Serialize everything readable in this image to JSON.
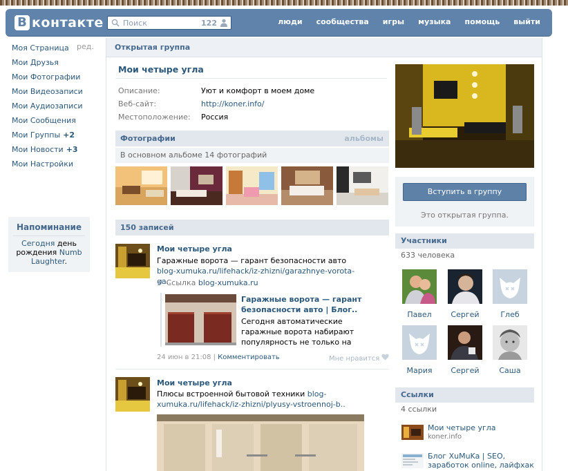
{
  "header": {
    "logo_letter": "В",
    "logo_text": "контакте",
    "search_placeholder": "Поиск",
    "search_count": "122",
    "nav": [
      "люди",
      "сообщества",
      "игры",
      "музыка",
      "помощь",
      "выйти"
    ]
  },
  "sidebar": {
    "items": [
      {
        "label": "Моя Страница",
        "badge": ""
      },
      {
        "label": "Мои Друзья",
        "badge": ""
      },
      {
        "label": "Мои Фотографии",
        "badge": ""
      },
      {
        "label": "Мои Видеозаписи",
        "badge": ""
      },
      {
        "label": "Мои Аудиозаписи",
        "badge": ""
      },
      {
        "label": "Мои Сообщения",
        "badge": ""
      },
      {
        "label": "Мои Группы",
        "badge": "+2"
      },
      {
        "label": "Мои Новости",
        "badge": "+3"
      },
      {
        "label": "Мои Настройки",
        "badge": ""
      }
    ],
    "edit_label": "ред.",
    "reminder": {
      "title": "Напоминание",
      "link1": "Сегодня",
      "text1": " день рождения ",
      "link2": "Numb Laughter",
      "text2": "."
    }
  },
  "group": {
    "section_title": "Открытая группа",
    "name": "Мои четыре угла",
    "info": [
      {
        "label": "Описание:",
        "value": "Уют и комфорт в моем доме",
        "is_link": false
      },
      {
        "label": "Веб-сайт:",
        "value": "http://koner.info/",
        "is_link": true
      },
      {
        "label": "Местоположение:",
        "value": "Россия",
        "is_link": false
      }
    ],
    "photos_title": "Фотографии",
    "albums_label": "альбомы",
    "photos_sub": "В основном альбоме 14 фотографий",
    "posts_title": "150 записей"
  },
  "posts": [
    {
      "author": "Мои четыре угла",
      "text": "Гаражные ворота — гарант безопасности авто ",
      "link": "blog-xumuka.ru/lifehack/iz-zhizni/garazhnye-vorota-ga..",
      "link_prefix": "Ссылка",
      "link_domain": "blog-xumuka.ru",
      "attach_title": "Гаражные ворота — гарант безопасности авто | Блог..",
      "attach_desc": "Сегодня автоматические гаражные ворота набирают популярность не только на",
      "date": "24 июн в 21:08",
      "comment": "Комментировать",
      "like": "Мне нравится"
    },
    {
      "author": "Мои четыре угла",
      "text": "Плюсы встроенной бытовой техники ",
      "link": "blog-xumuka.ru/lifehack/iz-zhizni/plyusy-vstroennoj-b.."
    }
  ],
  "right": {
    "join_button": "Вступить в группу",
    "open_text": "Это открытая группа.",
    "members_title": "Участники",
    "members_count": "633 человека",
    "members": [
      "Павел",
      "Сергей",
      "Глеб",
      "Мария",
      "Сергей",
      "Саша"
    ],
    "links_title": "Ссылки",
    "links_count": "4 ссылки",
    "links": [
      {
        "title": "Мои четыре угла",
        "sub": "koner.info"
      },
      {
        "title": "Блог XuMuKa | SEO, заработок online, лайфхак",
        "sub": ""
      }
    ]
  },
  "colors": {
    "header": "#5f83aa",
    "link": "#2b587a",
    "band": "#e1e7ed",
    "button": "#5d81a7"
  }
}
